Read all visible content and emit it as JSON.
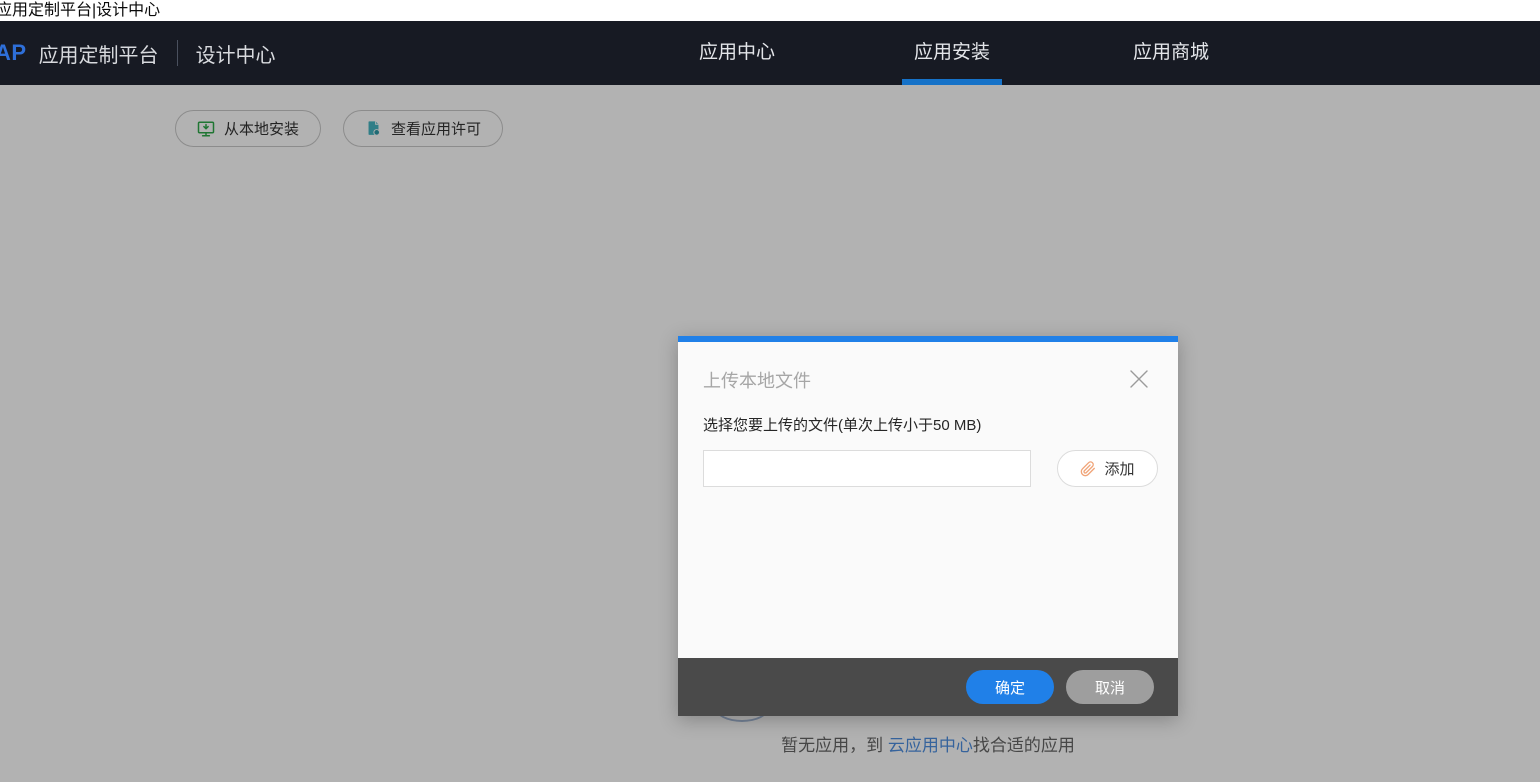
{
  "page": {
    "tab_title": "应用定制平台|设计中心"
  },
  "navbar": {
    "logo": "AP",
    "brand": "应用定制平台",
    "workspace": "设计中心",
    "items": [
      {
        "label": "应用中心",
        "active": false
      },
      {
        "label": "应用安装",
        "active": true
      },
      {
        "label": "应用商城",
        "active": false
      }
    ]
  },
  "toolbar": {
    "install_local_label": "从本地安装",
    "view_license_label": "查看应用许可"
  },
  "empty_state": {
    "text_prefix": "暂无应用，到 ",
    "link_label": "云应用中心",
    "text_suffix": "找合适的应用"
  },
  "modal": {
    "title": "上传本地文件",
    "file_hint": "选择您要上传的文件(单次上传小于50 MB)",
    "file_input_value": "",
    "add_button_label": "添加",
    "confirm_label": "确定",
    "cancel_label": "取消"
  },
  "colors": {
    "navbar_bg": "#171a23",
    "nav_underline_blue": "#1672c8",
    "modal_accent_blue": "#2080e8",
    "modal_footer_bg": "#4a4a4a",
    "cancel_gray": "#9e9e9e",
    "install_icon_green": "#2eaa4a",
    "license_icon_teal": "#45b5c2",
    "paperclip_orange": "#f0a478",
    "link_blue": "#4e8fe0"
  },
  "icons": {
    "install_local": "monitor-download-icon",
    "view_license": "license-document-icon",
    "add": "paperclip-icon",
    "close": "close-icon"
  }
}
